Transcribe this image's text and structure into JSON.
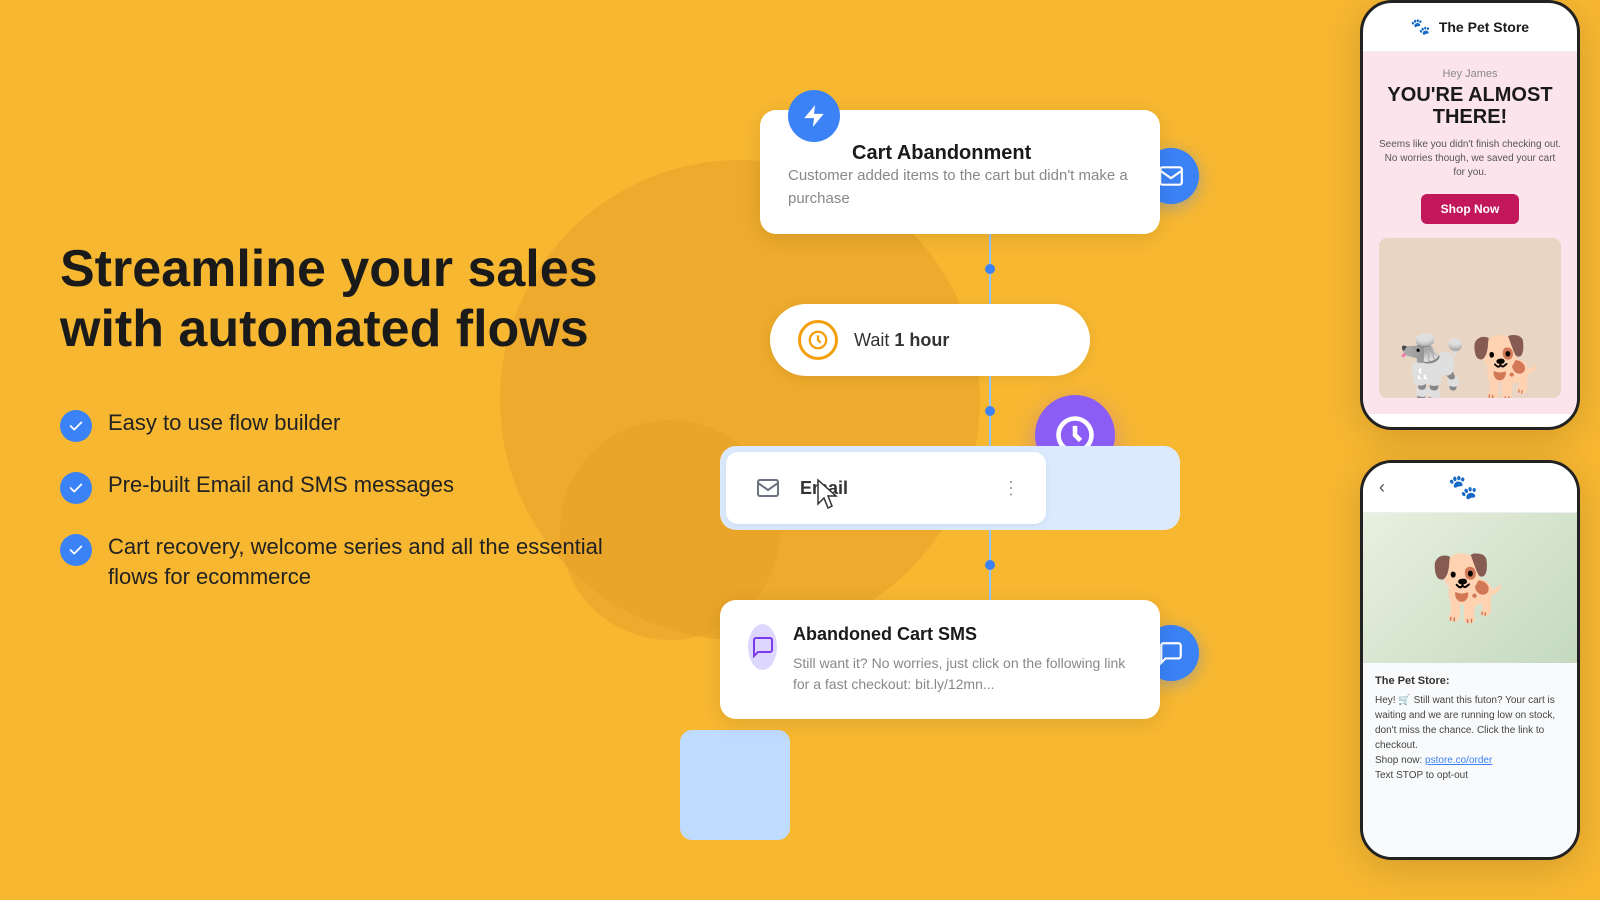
{
  "background_color": "#F7B731",
  "headline": {
    "line1": "Streamline your sales",
    "line2": "with automated flows"
  },
  "features": [
    "Easy to use flow builder",
    "Pre-built Email and SMS messages",
    "Cart recovery, welcome series and all the essential flows for ecommerce"
  ],
  "flow": {
    "cart_card": {
      "title": "Cart Abandonment",
      "description": "Customer added items to the cart but didn't make a purchase"
    },
    "wait_card": {
      "label": "Wait",
      "duration": "1 hour"
    },
    "email_card": {
      "label": "Email"
    },
    "sms_card": {
      "title": "Abandoned Cart SMS",
      "description": "Still want it? No worries, just click on the following link for a fast checkout: bit.ly/12mn..."
    }
  },
  "phone_top": {
    "store_name": "The Pet Store",
    "greeting": "Hey James",
    "headline": "YOU'RE ALMOST THERE!",
    "description": "Seems like you didn't finish checking out. No worries though, we saved your cart for you.",
    "button": "Shop Now"
  },
  "phone_bottom": {
    "sender": "The Pet Store:",
    "message": "Hey! 🛒 Still want this futon? Your cart is waiting and we are running low on stock, don't miss the chance. Click the link to checkout.",
    "shop_link": "pstore.co/order",
    "optout": "Text STOP to opt-out"
  }
}
